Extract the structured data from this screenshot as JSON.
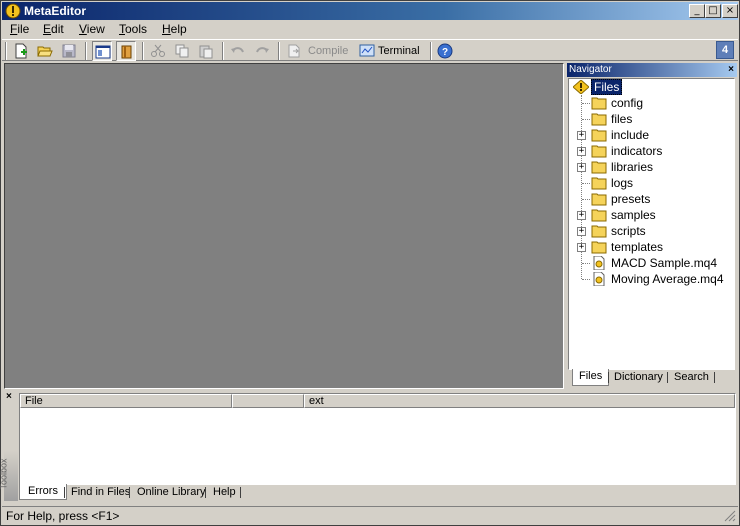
{
  "window": {
    "title": "MetaEditor"
  },
  "menu": {
    "items": [
      {
        "label": "File",
        "accel": "F",
        "rest": "ile"
      },
      {
        "label": "Edit",
        "accel": "E",
        "rest": "dit"
      },
      {
        "label": "View",
        "accel": "V",
        "rest": "iew"
      },
      {
        "label": "Tools",
        "accel": "T",
        "rest": "ools"
      },
      {
        "label": "Help",
        "accel": "H",
        "rest": "elp"
      }
    ]
  },
  "toolbar": {
    "compile_label": "Compile",
    "terminal_label": "Terminal",
    "badge": "4"
  },
  "navigator": {
    "title": "Navigator",
    "root": "Files",
    "items": [
      {
        "label": "config",
        "type": "folder",
        "expandable": false
      },
      {
        "label": "files",
        "type": "folder",
        "expandable": false
      },
      {
        "label": "include",
        "type": "folder",
        "expandable": true
      },
      {
        "label": "indicators",
        "type": "folder",
        "expandable": true
      },
      {
        "label": "libraries",
        "type": "folder",
        "expandable": true
      },
      {
        "label": "logs",
        "type": "folder",
        "expandable": false
      },
      {
        "label": "presets",
        "type": "folder",
        "expandable": false
      },
      {
        "label": "samples",
        "type": "folder",
        "expandable": true
      },
      {
        "label": "scripts",
        "type": "folder",
        "expandable": true
      },
      {
        "label": "templates",
        "type": "folder",
        "expandable": true
      },
      {
        "label": "MACD Sample.mq4",
        "type": "file",
        "expandable": false
      },
      {
        "label": "Moving Average.mq4",
        "type": "file",
        "expandable": false
      }
    ],
    "tabs": [
      "Files",
      "Dictionary",
      "Search"
    ]
  },
  "toolbox": {
    "side_label": "Toolbox",
    "columns": [
      "File",
      "",
      "ext"
    ],
    "tabs": [
      "Errors",
      "Find in Files",
      "Online Library",
      "Help"
    ]
  },
  "status": {
    "text": "For Help, press <F1>"
  },
  "colors": {
    "titlebar": "#0a246a",
    "face": "#d4d0c8",
    "editor_bg": "#808080",
    "folder": "#f5d35a"
  }
}
